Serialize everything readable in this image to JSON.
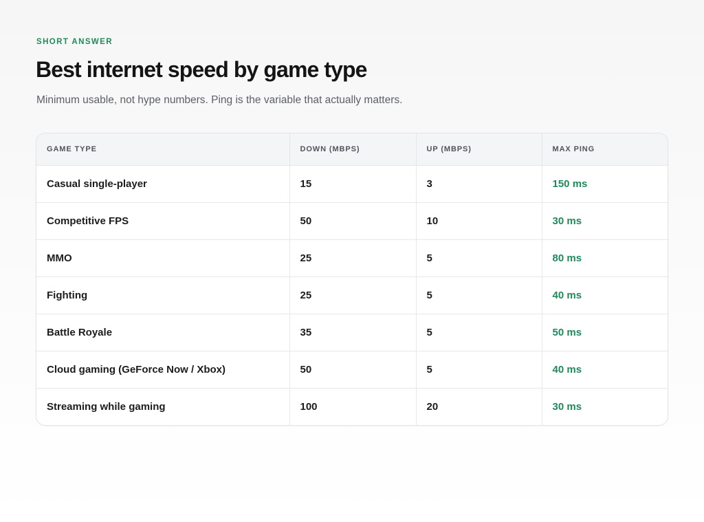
{
  "header": {
    "eyebrow": "SHORT ANSWER",
    "title": "Best internet speed by game type",
    "subtitle": "Minimum usable, not hype numbers. Ping is the variable that actually matters."
  },
  "colors": {
    "accent": "#1f8a5b",
    "text": "#141414",
    "muted": "#5b5f66"
  },
  "table": {
    "columns": [
      "GAME TYPE",
      "DOWN (MBPS)",
      "UP (MBPS)",
      "MAX PING"
    ],
    "rows": [
      {
        "game": "Casual single-player",
        "down": "15",
        "up": "3",
        "ping": "150 ms"
      },
      {
        "game": "Competitive FPS",
        "down": "50",
        "up": "10",
        "ping": "30 ms"
      },
      {
        "game": "MMO",
        "down": "25",
        "up": "5",
        "ping": "80 ms"
      },
      {
        "game": "Fighting",
        "down": "25",
        "up": "5",
        "ping": "40 ms"
      },
      {
        "game": "Battle Royale",
        "down": "35",
        "up": "5",
        "ping": "50 ms"
      },
      {
        "game": "Cloud gaming (GeForce Now / Xbox)",
        "down": "50",
        "up": "5",
        "ping": "40 ms"
      },
      {
        "game": "Streaming while gaming",
        "down": "100",
        "up": "20",
        "ping": "30 ms"
      }
    ]
  }
}
